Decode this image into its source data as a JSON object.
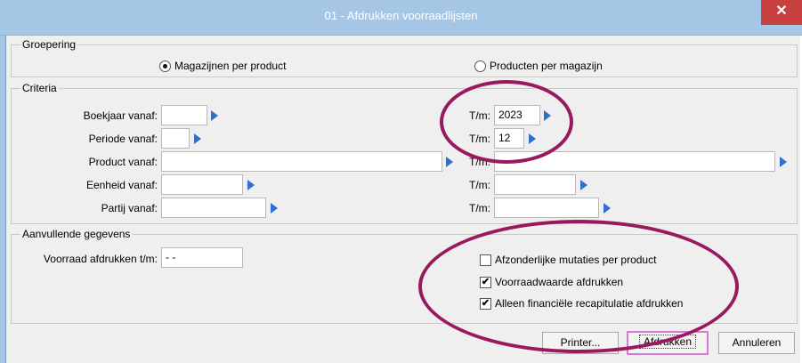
{
  "window": {
    "title": "01 - Afdrukken voorraadlijsten",
    "close_glyph": "✕"
  },
  "groepering": {
    "legend": "Groepering",
    "options": [
      {
        "label": "Magazijnen per product",
        "selected": true
      },
      {
        "label": "Producten per magazijn",
        "selected": false
      }
    ]
  },
  "criteria": {
    "legend": "Criteria",
    "rows": [
      {
        "label": "Boekjaar vanaf:",
        "from_value": "",
        "to_label": "T/m:",
        "to_value": "2023"
      },
      {
        "label": "Periode vanaf:",
        "from_value": "",
        "to_label": "T/m:",
        "to_value": "12"
      },
      {
        "label": "Product vanaf:",
        "from_value": "",
        "to_label": "T/m:",
        "to_value": ""
      },
      {
        "label": "Eenheid vanaf:",
        "from_value": "",
        "to_label": "T/m:",
        "to_value": ""
      },
      {
        "label": "Partij vanaf:",
        "from_value": "",
        "to_label": "T/m:",
        "to_value": ""
      }
    ]
  },
  "aanvullend": {
    "legend": "Aanvullende gegevens",
    "voorraad_label": "Voorraad afdrukken t/m:",
    "voorraad_value": "- -",
    "checks": [
      {
        "label": "Afzonderlijke mutaties per product",
        "checked": false
      },
      {
        "label": "Voorraadwaarde afdrukken",
        "checked": true
      },
      {
        "label": "Alleen financiële recapitulatie afdrukken",
        "checked": true
      }
    ]
  },
  "buttons": {
    "printer": "Printer...",
    "afdrukken": "Afdrukken",
    "annuleren": "Annuleren"
  },
  "annotation": {
    "color": "#99195f"
  },
  "icons": {
    "dropdown": "arrow-right-icon",
    "check": "✔"
  }
}
